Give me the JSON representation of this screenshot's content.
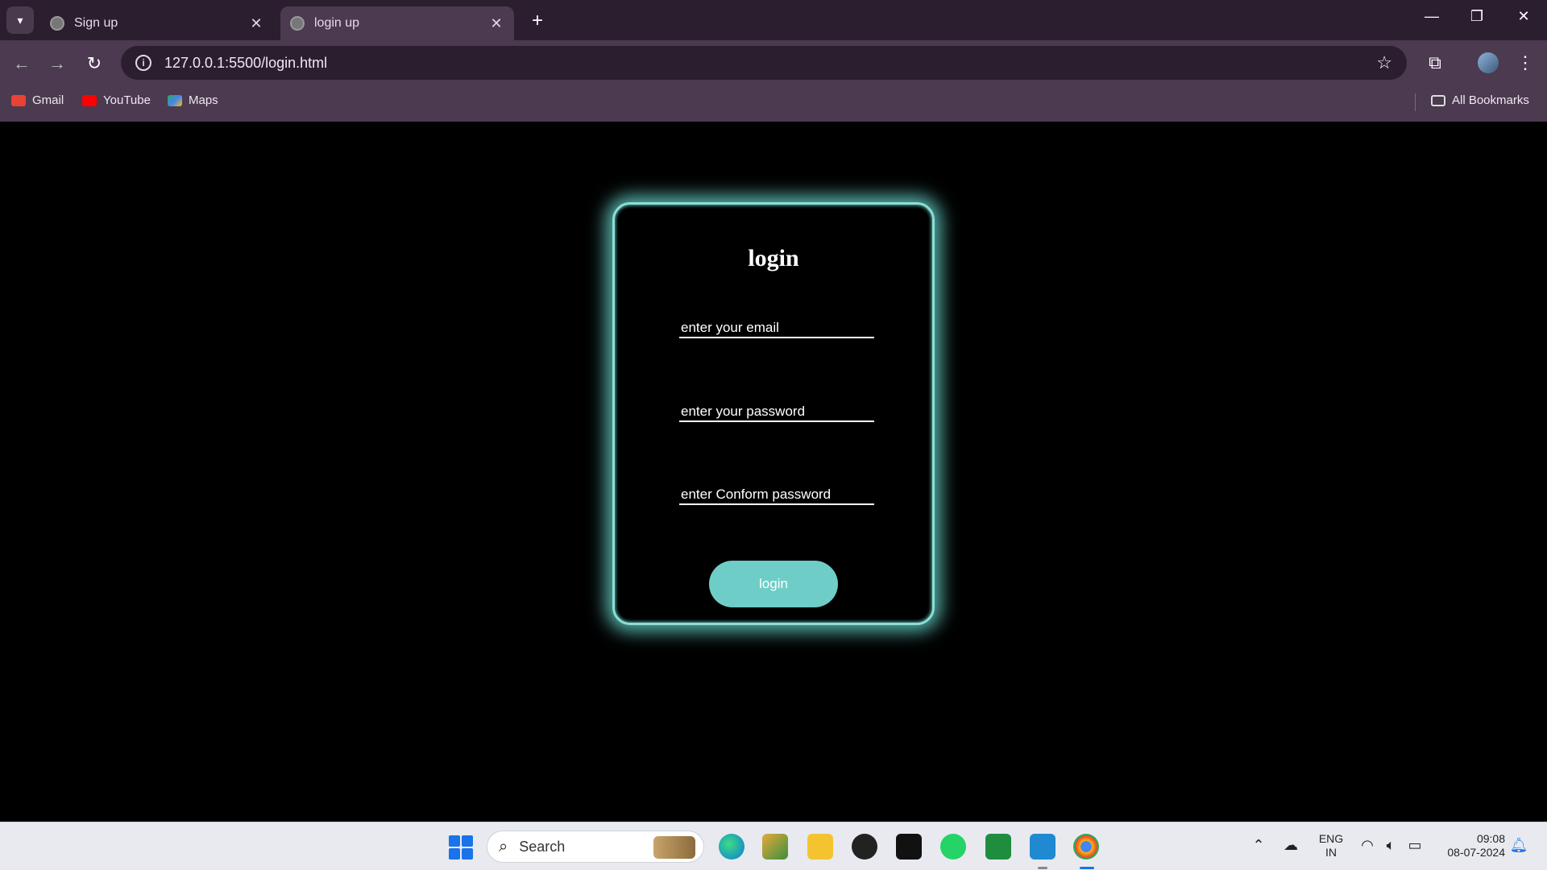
{
  "browser": {
    "tabs": [
      {
        "label": "Sign up",
        "close": "✕"
      },
      {
        "label": "login up",
        "close": "✕"
      }
    ],
    "new_tab": "+",
    "window_controls": {
      "minimize": "—",
      "restore": "❐",
      "close": "✕"
    },
    "nav": {
      "back": "←",
      "forward": "→",
      "reload": "↻"
    },
    "url": "127.0.0.1:5500/login.html",
    "star": "☆",
    "extensions": "⧉",
    "menu": "⋮",
    "bookmarks": [
      {
        "label": "Gmail",
        "color": "#ea4335"
      },
      {
        "label": "YouTube",
        "color": "#ff0000"
      },
      {
        "label": "Maps",
        "color": "#34a853"
      }
    ],
    "all_bookmarks": "All Bookmarks"
  },
  "login_card": {
    "title": "login",
    "email_placeholder": "enter your email",
    "password_placeholder": "enter your password",
    "confirm_placeholder": "enter Conform password",
    "button_label": "login",
    "accent_color": "#6fcdc7"
  },
  "taskbar": {
    "search_label": "Search",
    "lang_line1": "ENG",
    "lang_line2": "IN",
    "time": "09:08",
    "date": "08-07-2024"
  }
}
